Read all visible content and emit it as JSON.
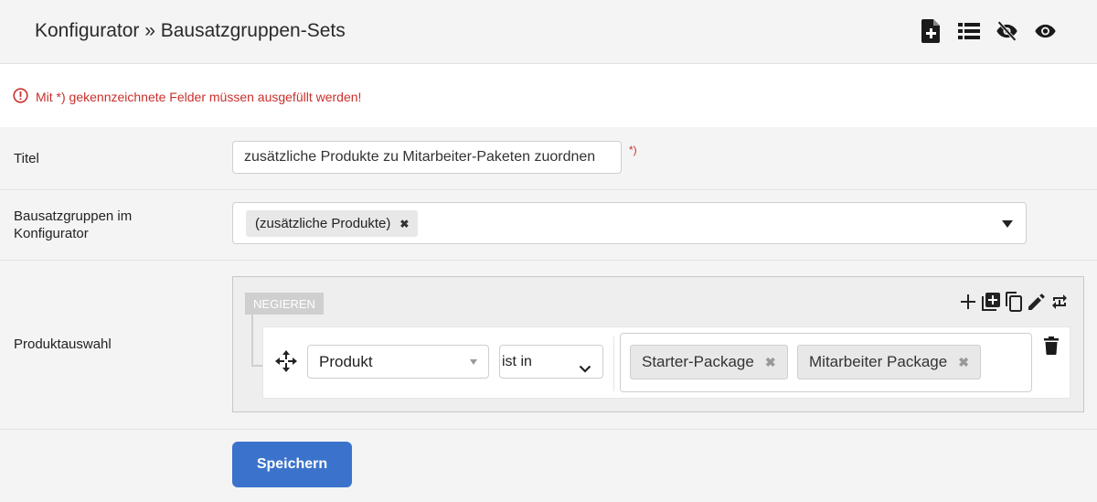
{
  "header": {
    "title": "Konfigurator » Bausatzgruppen-Sets",
    "icons": [
      "add-document-icon",
      "list-icon",
      "eye-slash-icon",
      "eye-icon"
    ]
  },
  "notice": {
    "icon": "exclamation-circle-icon",
    "text": "Mit *) gekennzeichnete Felder müssen ausgefüllt werden!"
  },
  "form": {
    "titel": {
      "label": "Titel",
      "value": "zusätzliche Produkte zu Mitarbeiter-Paketen zuordnen",
      "required_mark": "*)"
    },
    "bausatzgruppen": {
      "label_line1": "Bausatzgruppen im",
      "label_line2": "Konfigurator",
      "tags": [
        "(zusätzliche Produkte)"
      ],
      "remove_glyph": "✖"
    },
    "produktauswahl": {
      "label": "Produktauswahl",
      "negate_label": "NEGIEREN",
      "toolbar_icons": [
        "plus-icon",
        "add-group-icon",
        "copy-icon",
        "pencil-icon",
        "swap-icon"
      ],
      "rule": {
        "field": "Produkt",
        "operator": "ist in",
        "values": [
          "Starter-Package",
          "Mitarbeiter Package"
        ],
        "remove_glyph": "✖"
      }
    }
  },
  "actions": {
    "save_label": "Speichern"
  },
  "colors": {
    "primary": "#3b73cc",
    "error": "#c9302c",
    "background": "#f4f4f4",
    "negate_bg": "#cfcfcf"
  }
}
